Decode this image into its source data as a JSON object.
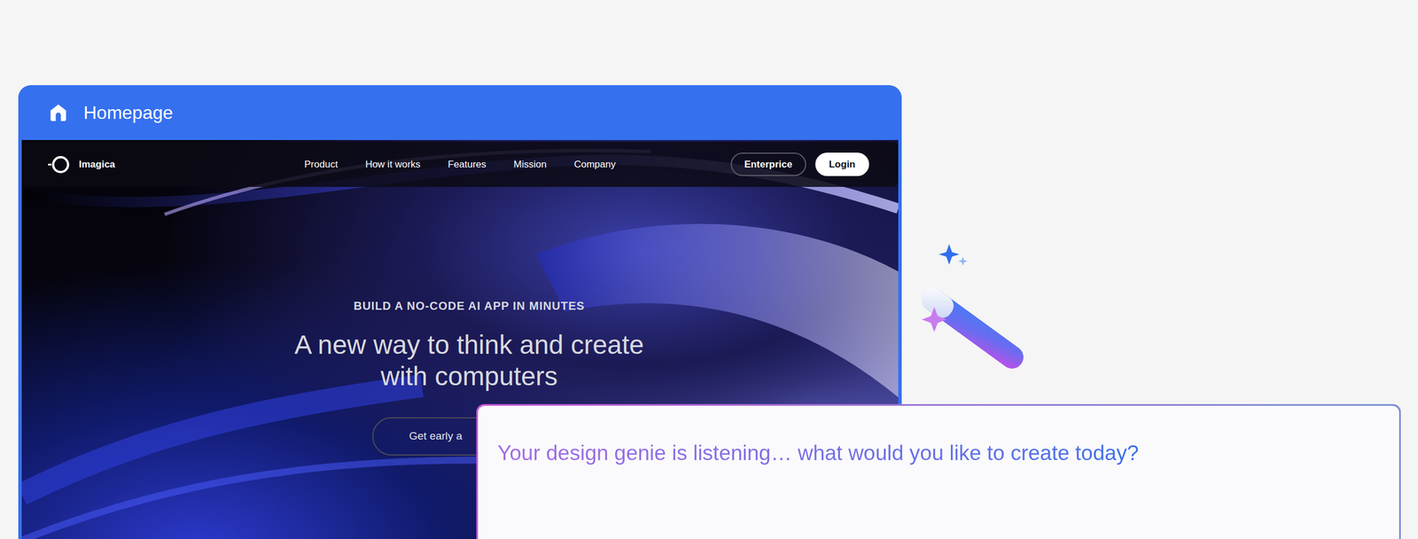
{
  "card": {
    "title": "Homepage"
  },
  "site": {
    "logo": "Imagica",
    "nav": [
      "Product",
      "How it works",
      "Features",
      "Mission",
      "Company"
    ],
    "buttons": [
      {
        "label": "Enterprice",
        "kind": "outline"
      },
      {
        "label": "Login",
        "kind": "solid"
      }
    ],
    "eyebrow": "BUILD A NO-CODE AI APP IN MINUTES",
    "headline": [
      "A new way to think and create",
      "with computers"
    ],
    "cta": "Get early a"
  },
  "prompt": {
    "text": "Your design genie is listening… what would you like to create today?"
  }
}
